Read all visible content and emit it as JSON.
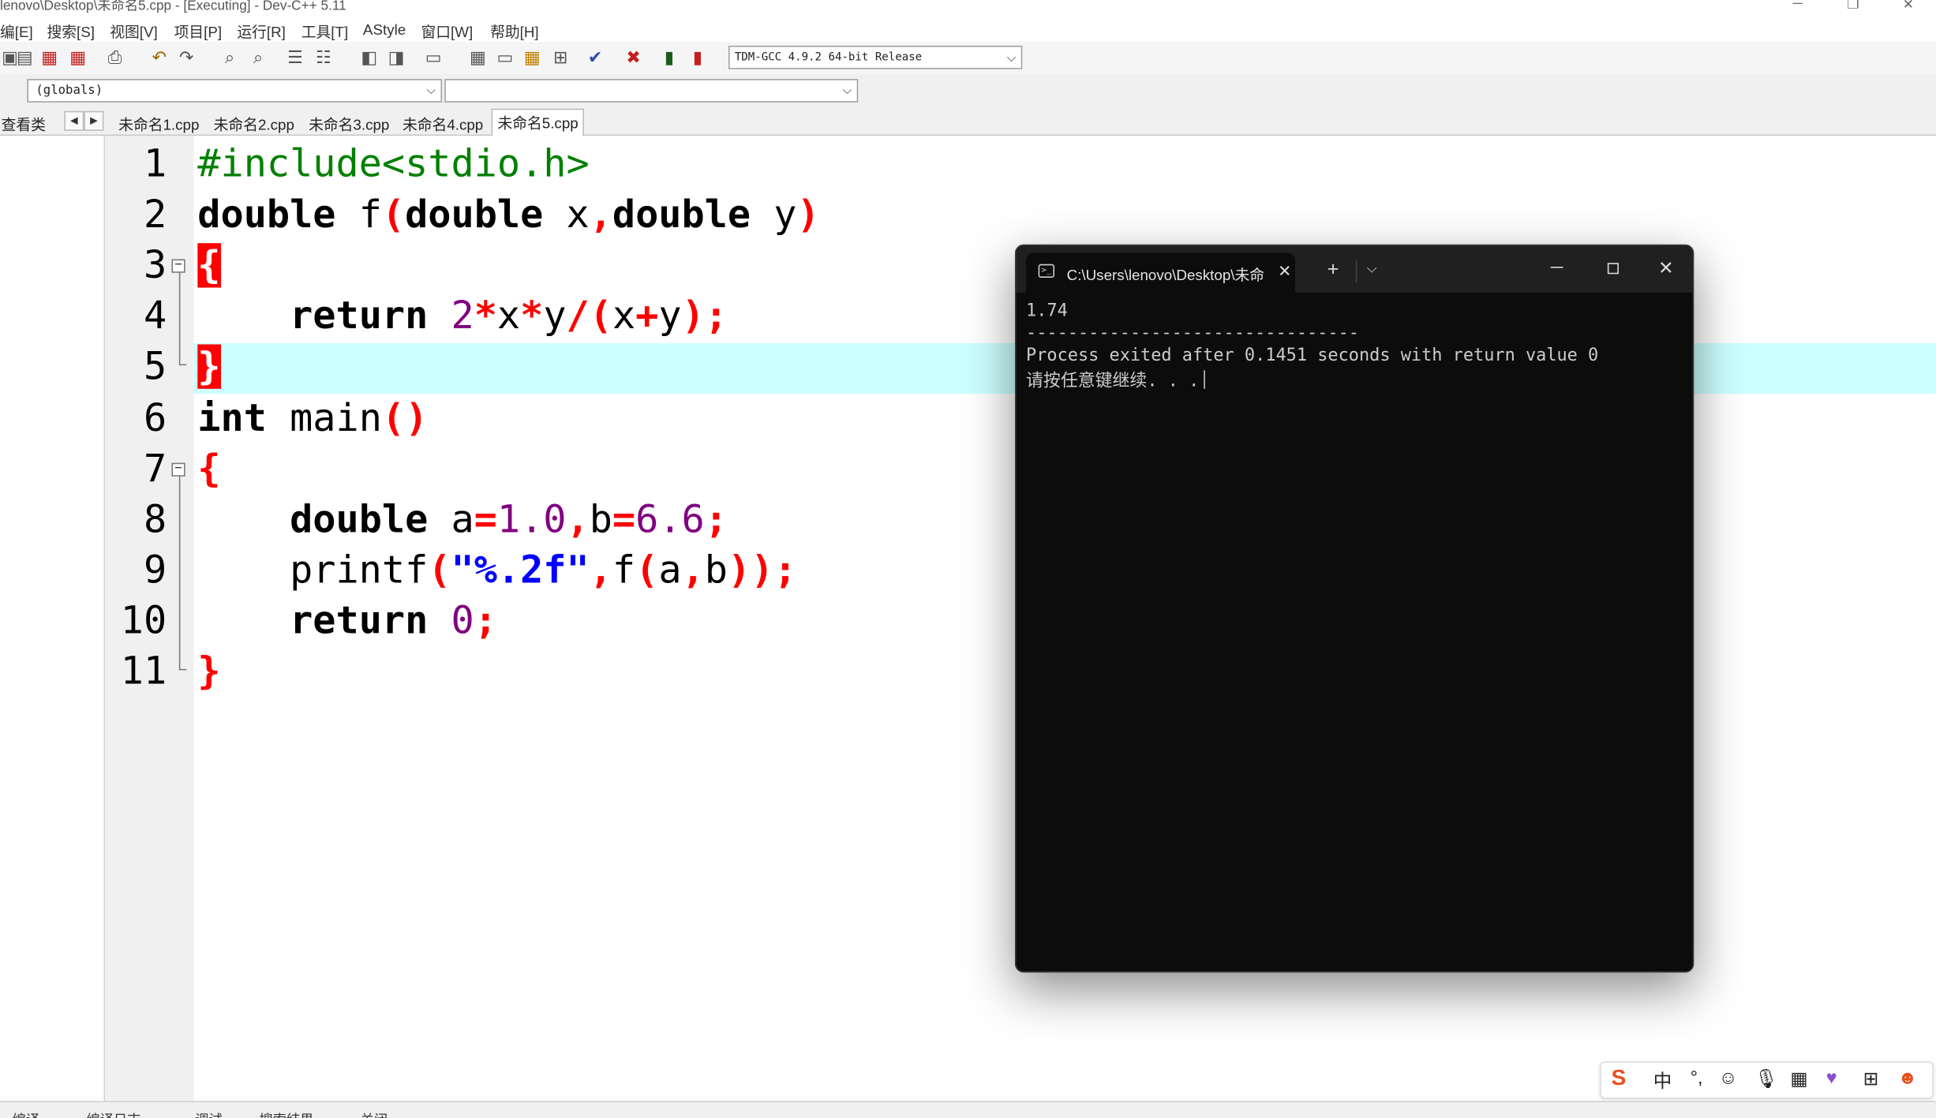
{
  "window": {
    "title": "lenovo\\Desktop\\未命名5.cpp - [Executing] - Dev-C++ 5.11"
  },
  "menu": [
    "编[E]",
    "搜索[S]",
    "视图[V]",
    "项目[P]",
    "运行[R]",
    "工具[T]",
    "AStyle",
    "窗口[W]",
    "帮助[H]"
  ],
  "toolbar": {
    "compiler": "TDM-GCC 4.9.2 64-bit Release"
  },
  "scope": {
    "globals": "(globals)",
    "member": ""
  },
  "side_tab": "查看类",
  "tabs": [
    "未命名1.cpp",
    "未命名2.cpp",
    "未命名3.cpp",
    "未命名4.cpp",
    "未命名5.cpp"
  ],
  "active_tab": "未命名5.cpp",
  "code": {
    "line_numbers": [
      "1",
      "2",
      "3",
      "4",
      "5",
      "6",
      "7",
      "8",
      "9",
      "10",
      "11"
    ],
    "highlighted_line": 5
  },
  "terminal": {
    "tab_title": "C:\\Users\\lenovo\\Desktop\\未命",
    "lines": [
      "1.74",
      "--------------------------------",
      "Process exited after 0.1451 seconds with return value 0",
      "请按任意键继续. . ."
    ]
  },
  "ime": {
    "mode": "中"
  },
  "bottom_tabs": [
    "编译",
    "编译日志",
    "调试",
    "搜索结果",
    "关闭"
  ]
}
